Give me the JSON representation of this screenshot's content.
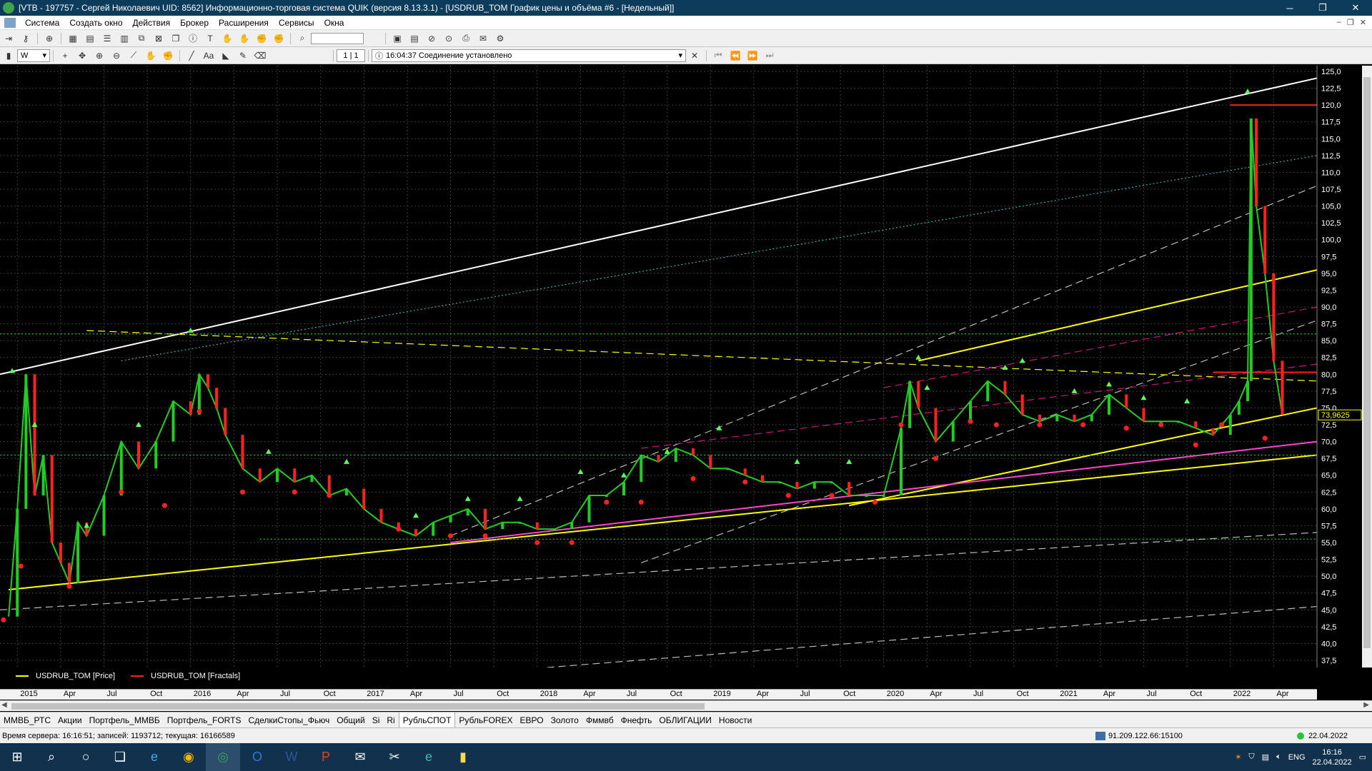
{
  "window": {
    "title": "[VTB - 197757 - Сергей Николаевич UID: 8562] Информационно-торговая система QUIK (версия 8.13.3.1) - [USDRUB_TOM График цены и объёма #6 - [Недельный]]",
    "minimize": "─",
    "maximize": "❐",
    "close": "✕"
  },
  "menu": {
    "items": [
      "Система",
      "Создать окно",
      "Действия",
      "Брокер",
      "Расширения",
      "Сервисы",
      "Окна"
    ],
    "mdi": [
      "–",
      "❐",
      "✕"
    ]
  },
  "toolbar2": {
    "interval": "W",
    "page": "1 | 1",
    "status": "16:04:37 Соединение установлено"
  },
  "chart_data": {
    "type": "line",
    "title": "",
    "symbol": "USDRUB_TOM",
    "ylim": [
      37.5,
      125.0
    ],
    "y_ticks": [
      "125,0",
      "122,5",
      "120,0",
      "117,5",
      "115,0",
      "112,5",
      "110,0",
      "107,5",
      "105,0",
      "102,5",
      "100,0",
      "97,5",
      "95,0",
      "92,5",
      "90,0",
      "87,5",
      "85,0",
      "82,5",
      "80,0",
      "77,5",
      "75,0",
      "72,5",
      "70,0",
      "67,5",
      "65,0",
      "62,5",
      "60,0",
      "57,5",
      "55,0",
      "52,5",
      "50,0",
      "47,5",
      "45,0",
      "42,5",
      "40,0",
      "37,5"
    ],
    "current_price": "73,9625",
    "x_ticks": [
      "2015",
      "Apr",
      "Jul",
      "Oct",
      "2016",
      "Apr",
      "Jul",
      "Oct",
      "2017",
      "Apr",
      "Jul",
      "Oct",
      "2018",
      "Apr",
      "Jul",
      "Oct",
      "2019",
      "Apr",
      "Jul",
      "Oct",
      "2020",
      "Apr",
      "Jul",
      "Oct",
      "2021",
      "Apr",
      "Jul",
      "Oct",
      "2022",
      "Apr"
    ],
    "x": [
      2014.95,
      2015.0,
      2015.05,
      2015.1,
      2015.15,
      2015.2,
      2015.25,
      2015.3,
      2015.35,
      2015.4,
      2015.5,
      2015.6,
      2015.7,
      2015.8,
      2015.9,
      2016.0,
      2016.05,
      2016.1,
      2016.15,
      2016.2,
      2016.3,
      2016.4,
      2016.5,
      2016.6,
      2016.7,
      2016.8,
      2016.9,
      2017.0,
      2017.1,
      2017.2,
      2017.3,
      2017.4,
      2017.5,
      2017.6,
      2017.7,
      2017.8,
      2017.9,
      2018.0,
      2018.1,
      2018.2,
      2018.3,
      2018.4,
      2018.5,
      2018.6,
      2018.7,
      2018.8,
      2018.9,
      2019.0,
      2019.1,
      2019.2,
      2019.3,
      2019.4,
      2019.5,
      2019.6,
      2019.7,
      2019.8,
      2019.9,
      2020.0,
      2020.1,
      2020.15,
      2020.2,
      2020.3,
      2020.4,
      2020.5,
      2020.6,
      2020.7,
      2020.8,
      2020.9,
      2021.0,
      2021.1,
      2021.2,
      2021.3,
      2021.4,
      2021.5,
      2021.6,
      2021.7,
      2021.8,
      2021.9,
      2022.0,
      2022.05,
      2022.1,
      2022.12,
      2022.15,
      2022.2,
      2022.25,
      2022.3
    ],
    "series": [
      {
        "color": "#ffff00",
        "values": [
          44,
          60,
          80,
          62,
          68,
          55,
          52,
          49,
          58,
          56,
          62,
          70,
          66,
          70,
          76,
          74,
          80,
          78,
          75,
          71,
          66,
          64,
          66,
          64,
          65,
          62,
          63,
          60,
          58,
          57,
          56,
          58,
          59,
          60,
          57,
          58,
          58,
          57,
          57,
          58,
          62,
          62,
          64,
          68,
          67,
          69,
          68,
          66,
          66,
          65,
          64,
          64,
          63,
          64,
          64,
          62,
          62,
          62,
          72,
          79,
          75,
          70,
          73,
          76,
          79,
          77,
          74,
          73,
          74,
          73,
          74,
          77,
          75,
          73,
          73,
          73,
          72,
          71,
          74,
          76,
          79,
          118,
          105,
          95,
          82,
          74
        ]
      }
    ],
    "fractals_up": [
      [
        2014.97,
        80.5
      ],
      [
        2015.1,
        72.5
      ],
      [
        2015.4,
        57.5
      ],
      [
        2015.7,
        72.5
      ],
      [
        2016.0,
        86.5
      ],
      [
        2016.45,
        68.5
      ],
      [
        2016.9,
        67
      ],
      [
        2017.3,
        59
      ],
      [
        2017.6,
        61.5
      ],
      [
        2017.9,
        61.5
      ],
      [
        2018.25,
        65.5
      ],
      [
        2018.5,
        65
      ],
      [
        2018.75,
        68.5
      ],
      [
        2019.05,
        72
      ],
      [
        2019.5,
        67
      ],
      [
        2019.8,
        67
      ],
      [
        2020.2,
        82.5
      ],
      [
        2020.25,
        78
      ],
      [
        2020.7,
        81
      ],
      [
        2020.8,
        82
      ],
      [
        2021.1,
        77.5
      ],
      [
        2021.3,
        78.5
      ],
      [
        2021.5,
        76.5
      ],
      [
        2021.75,
        76
      ],
      [
        2022.1,
        122
      ]
    ],
    "fractals_down": [
      [
        2014.92,
        43.5
      ],
      [
        2015.02,
        51.5
      ],
      [
        2015.3,
        48.5
      ],
      [
        2015.6,
        62.5
      ],
      [
        2015.85,
        60.5
      ],
      [
        2016.05,
        74.5
      ],
      [
        2016.3,
        62.5
      ],
      [
        2016.6,
        62.5
      ],
      [
        2016.8,
        62
      ],
      [
        2017.2,
        57
      ],
      [
        2017.5,
        56
      ],
      [
        2017.7,
        56
      ],
      [
        2018.0,
        55
      ],
      [
        2018.2,
        55
      ],
      [
        2018.4,
        61
      ],
      [
        2018.6,
        61
      ],
      [
        2018.9,
        64.5
      ],
      [
        2019.2,
        64
      ],
      [
        2019.45,
        62
      ],
      [
        2019.7,
        62
      ],
      [
        2019.95,
        61
      ],
      [
        2020.1,
        72.5
      ],
      [
        2020.3,
        67.5
      ],
      [
        2020.5,
        73
      ],
      [
        2020.65,
        72.5
      ],
      [
        2020.9,
        72.5
      ],
      [
        2021.15,
        72.5
      ],
      [
        2021.4,
        72
      ],
      [
        2021.6,
        72.5
      ],
      [
        2021.8,
        69.5
      ],
      [
        2021.95,
        72.5
      ],
      [
        2022.2,
        70.5
      ]
    ],
    "trendlines": [
      {
        "color": "#ffffff",
        "style": "solid",
        "from": [
          2014.9,
          80
        ],
        "to": [
          2022.5,
          124
        ]
      },
      {
        "color": "#3aa9b5",
        "style": "dotted",
        "from": [
          2015.6,
          82
        ],
        "to": [
          2022.5,
          112.5
        ]
      },
      {
        "color": "#bbbbbb",
        "style": "dashed",
        "from": [
          2017.5,
          56
        ],
        "to": [
          2022.5,
          108
        ]
      },
      {
        "color": "#bbbbbb",
        "style": "dashed",
        "from": [
          2018.6,
          52
        ],
        "to": [
          2022.5,
          88
        ]
      },
      {
        "color": "#ffff00",
        "style": "solid",
        "from": [
          2020.2,
          82
        ],
        "to": [
          2022.5,
          95.5
        ]
      },
      {
        "color": "#ffff00",
        "style": "solid",
        "from": [
          2014.95,
          48
        ],
        "to": [
          2022.5,
          68
        ]
      },
      {
        "color": "#ffff00",
        "style": "solid",
        "from": [
          2019.8,
          60.5
        ],
        "to": [
          2022.5,
          75
        ]
      },
      {
        "color": "#ff44cc",
        "style": "solid",
        "from": [
          2017.5,
          55
        ],
        "to": [
          2022.5,
          70
        ]
      },
      {
        "color": "#ffff00",
        "style": "dashed",
        "from": [
          2015.4,
          86.5
        ],
        "to": [
          2022.5,
          79
        ]
      },
      {
        "color": "#c8147a",
        "style": "dashed",
        "from": [
          2020.0,
          78
        ],
        "to": [
          2022.5,
          90
        ]
      },
      {
        "color": "#c8147a",
        "style": "dashed",
        "from": [
          2018.6,
          69
        ],
        "to": [
          2022.5,
          81.5
        ]
      },
      {
        "color": "#00cc00",
        "style": "dotted",
        "from": [
          2014.9,
          86
        ],
        "to": [
          2022.5,
          86
        ]
      },
      {
        "color": "#00cc00",
        "style": "dotted",
        "from": [
          2014.9,
          68
        ],
        "to": [
          2022.5,
          68
        ]
      },
      {
        "color": "#00cc00",
        "style": "dotted",
        "from": [
          2016.4,
          55.5
        ],
        "to": [
          2022.5,
          55.5
        ]
      },
      {
        "color": "#ff2020",
        "style": "solid",
        "from": [
          2022.0,
          120
        ],
        "to": [
          2022.5,
          120
        ]
      },
      {
        "color": "#ff2020",
        "style": "solid",
        "from": [
          2021.9,
          80.3
        ],
        "to": [
          2022.5,
          80.3
        ]
      },
      {
        "color": "#bbbbbb",
        "style": "dashed",
        "from": [
          2014.9,
          45
        ],
        "to": [
          2022.5,
          56.5
        ]
      },
      {
        "color": "#bbbbbb",
        "style": "dashed",
        "from": [
          2014.9,
          30
        ],
        "to": [
          2022.5,
          45.5
        ]
      }
    ]
  },
  "legend": {
    "price": "USDRUB_TOM [Price]",
    "fractals": "USDRUB_TOM [Fractals]",
    "price_color": "#ffff00",
    "fractals_color": "#ff2020"
  },
  "tabs": [
    "ММВБ_РТС",
    "Акции",
    "Портфель_ММВБ",
    "Портфель_FORTS",
    "СделкиСтопы_Фьюч",
    "Общий",
    "Si",
    "Ri",
    "РубльСПОТ",
    "РубльFOREX",
    "ЕВРО",
    "Золото",
    "Фммвб",
    "Фнефть",
    "ОБЛИГАЦИИ",
    "Новости"
  ],
  "active_tab": "РубльСПОТ",
  "status": {
    "server": "Время сервера: 16:16:51; записей: 1193712; текущая: 16166589",
    "connection": "91.209.122.66:15100",
    "date": "22.04.2022"
  },
  "taskbar": {
    "lang": "ENG",
    "time": "16:16",
    "date": "22.04.2022"
  }
}
